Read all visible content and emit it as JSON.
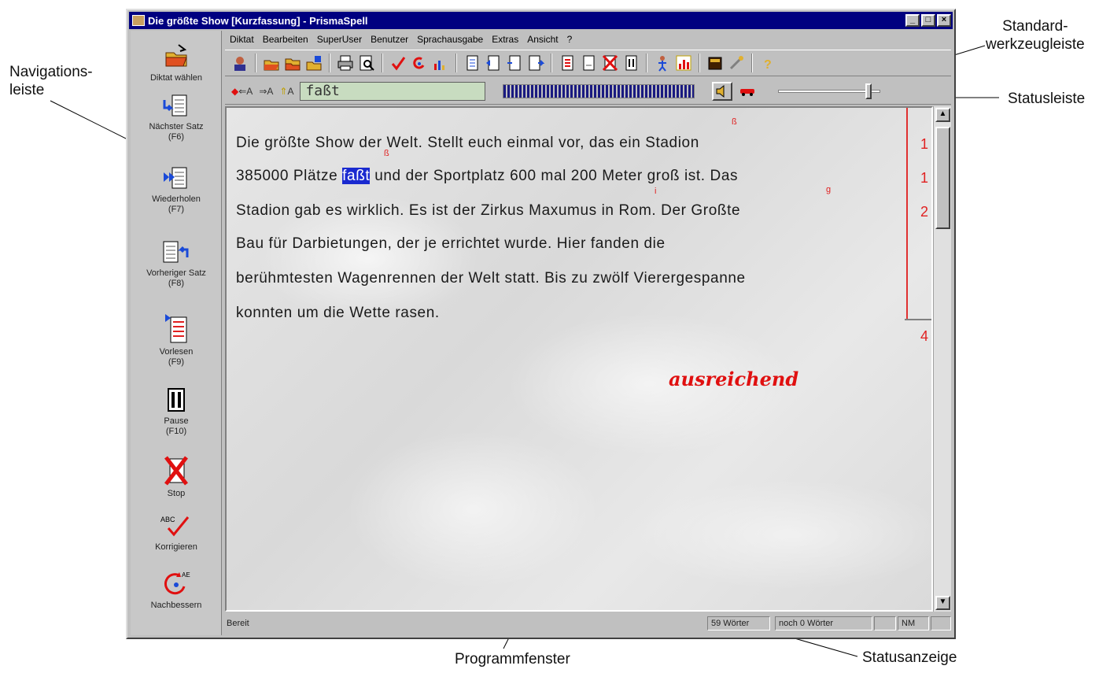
{
  "window": {
    "title": "Die größte Show [Kurzfassung] - PrismaSpell",
    "controls": [
      "_",
      "□",
      "×"
    ]
  },
  "menu": [
    "Diktat",
    "Bearbeiten",
    "SuperUser",
    "Benutzer",
    "Sprachausgabe",
    "Extras",
    "Ansicht",
    "?"
  ],
  "navigation": [
    {
      "label": "Diktat wählen",
      "icon": "open-folder-icon"
    },
    {
      "label": "Nächster Satz\n(F6)",
      "icon": "next-sentence-icon"
    },
    {
      "label": "Wiederholen\n(F7)",
      "icon": "repeat-icon"
    },
    {
      "label": "Vorheriger Satz\n(F8)",
      "icon": "previous-sentence-icon"
    },
    {
      "label": "Vorlesen\n(F9)",
      "icon": "read-aloud-icon"
    },
    {
      "label": "Pause\n(F10)",
      "icon": "pause-icon"
    },
    {
      "label": "Stop",
      "icon": "stop-icon"
    },
    {
      "label": "Korrigieren",
      "icon": "correct-icon"
    },
    {
      "label": "Nachbessern",
      "icon": "improve-icon"
    }
  ],
  "status_row": {
    "word_prev": "A",
    "word_next": "A",
    "case_toggle": "A",
    "current_word": "faßt"
  },
  "document": {
    "lines": [
      "Die größte Show der Welt. Stellt euch einmal vor, das ein Stadion",
      "385000 Plätze faßt und der Sportplatz 600 mal 200 Meter groß ist. Das",
      "Stadion gab es wirklich. Es ist der Zirkus Maxumus in Rom. Der Großte",
      "Bau für Darbietungen, der je errichtet wurde. Hier fanden die",
      "berühmtesten Wagenrennen der Welt statt. Bis zu zwölf Vierergespanne",
      "konnten um die Wette rasen."
    ],
    "line2_before": "385000 Plätze ",
    "line2_selected": "faßt",
    "line2_after": " und der Sportplatz 600 mal 200 Meter groß ist. Das",
    "corrections": [
      "ß",
      "ß",
      "i",
      "g"
    ],
    "error_counts": [
      "1",
      "1",
      "2"
    ],
    "total_errors": "4",
    "grade": "ausreichend"
  },
  "statusbar": {
    "ready": "Bereit",
    "words": "59 Wörter",
    "remaining": "noch 0 Wörter",
    "mode": "NM"
  },
  "callouts": {
    "navigation": "Navigations-\nleiste",
    "toolbar": "Standard-\nwerkzeugleiste",
    "statusrow": "Statusleiste",
    "window": "Programmfenster",
    "statusdisplay": "Statusanzeige"
  },
  "colors": {
    "titlebar": "#000080",
    "error_red": "#e02020",
    "selection": "#1a2ad0"
  }
}
